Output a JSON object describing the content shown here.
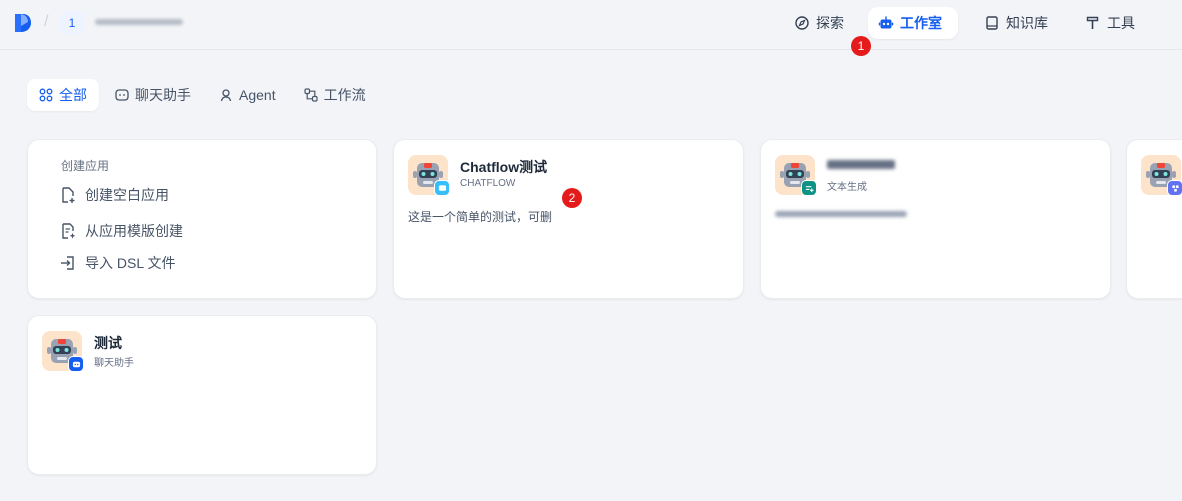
{
  "header": {
    "workspace_initial": "1",
    "workspace_name": "",
    "nav": [
      {
        "label": "探索",
        "icon": "compass-icon",
        "active": false
      },
      {
        "label": "工作室",
        "icon": "robot-icon",
        "active": true
      },
      {
        "label": "知识库",
        "icon": "book-icon",
        "active": false
      },
      {
        "label": "工具",
        "icon": "hammer-icon",
        "active": false
      }
    ]
  },
  "markers": [
    "1",
    "2"
  ],
  "tabs": [
    {
      "label": "全部",
      "icon": "grid-icon",
      "active": true
    },
    {
      "label": "聊天助手",
      "icon": "chat-bot-icon",
      "active": false
    },
    {
      "label": "Agent",
      "icon": "agent-icon",
      "active": false
    },
    {
      "label": "工作流",
      "icon": "workflow-icon",
      "active": false
    }
  ],
  "create": {
    "title": "创建应用",
    "items": [
      {
        "label": "创建空白应用",
        "icon": "file-plus-icon"
      },
      {
        "label": "从应用模版创建",
        "icon": "template-icon"
      },
      {
        "label": "导入 DSL 文件",
        "icon": "import-icon"
      }
    ]
  },
  "apps": [
    {
      "name": "Chatflow测试",
      "mode": "CHATFLOW",
      "description": "这是一个简单的测试，可删",
      "badge_color": "#36bffa",
      "badge_icon": "chat-bubble-icon"
    },
    {
      "name": "",
      "mode": "文本生成",
      "description": "",
      "badge_color": "#0e9384",
      "badge_icon": "text-gen-icon"
    },
    {
      "name": "",
      "mode": "",
      "description": "",
      "badge_color": "#6172f3",
      "badge_icon": "agent-icon"
    },
    {
      "name": "测试",
      "mode": "聊天助手",
      "description": "",
      "badge_color": "#155eef",
      "badge_icon": "chat-bot-icon"
    }
  ],
  "colors": {
    "accent": "#155eef",
    "marker": "#e51b1b",
    "avatar_bg": "#fde3c9"
  }
}
